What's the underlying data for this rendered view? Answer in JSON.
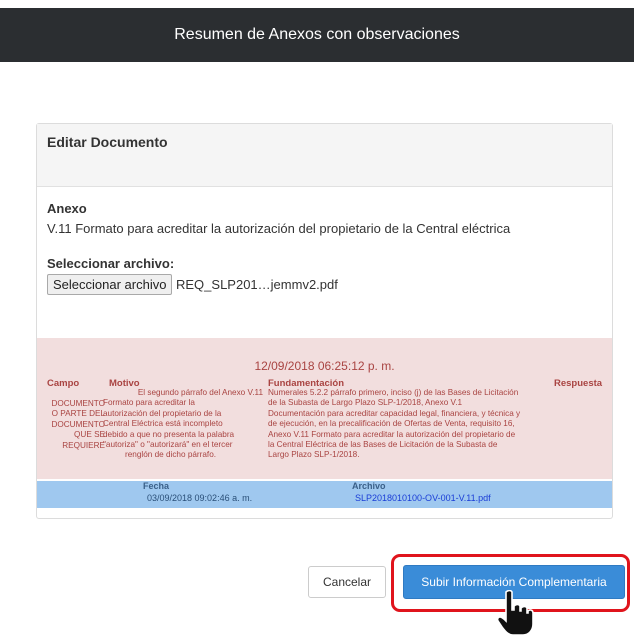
{
  "header": {
    "title": "Resumen de Anexos con observaciones"
  },
  "card": {
    "title": "Editar Documento",
    "anexo_label": "Anexo",
    "anexo_value": "V.11 Formato para acreditar la autorización del propietario de la Central eléctrica",
    "file_label": "Seleccionar archivo:",
    "file_button": "Seleccionar archivo",
    "file_name": "REQ_SLP201…jemmv2.pdf"
  },
  "observation": {
    "date": "12/09/2018 06:25:12 p. m.",
    "headers": {
      "campo": "Campo",
      "motivo": "Motivo",
      "fundamentacion": "Fundamentación",
      "respuesta": "Respuesta"
    },
    "campo_lines": [
      "DOCUMENTO",
      "O PARTE DEL",
      "DOCUMENTO",
      "QUE SE",
      "REQUIERE"
    ],
    "motivo_lines": [
      "El segundo párrafo del Anexo V.11",
      "Formato para acreditar la",
      "autorización del propietario de la",
      "Central Eléctrica está incompleto",
      "debido a que no presenta la palabra",
      "\"autoriza\" o \"autorizará\" en el tercer",
      "renglón de dicho párrafo."
    ],
    "fundamentacion_lines": [
      "Numerales 5.2.2 párrafo primero, inciso (j) de las Bases de Licitación",
      "de la Subasta de Largo Plazo SLP-1/2018, Anexo V.1",
      "Documentación para acreditar capacidad legal, financiera, y técnica y",
      "de ejecución, en la precalificación de Ofertas de Venta, requisito 16,",
      "Anexo V.11 Formato para acreditar la autorización del propietario de",
      "la Central Eléctrica de las Bases de Licitación de la Subasta de",
      "Largo Plazo SLP-1/2018."
    ],
    "file": {
      "fecha_label": "Fecha",
      "fecha_value": "03/09/2018 09:02:46 a. m.",
      "archivo_label": "Archivo",
      "archivo_value": "SLP2018010100-OV-001-V.11.pdf"
    }
  },
  "actions": {
    "cancel": "Cancelar",
    "submit": "Subir Información Complementaria"
  },
  "colors": {
    "header_bg": "#2b2e31",
    "alert_bg": "#f2dede",
    "alert_text": "#a94442",
    "file_row_bg": "#9fc8ef",
    "primary": "#3a8cd8",
    "highlight": "#e0141c"
  },
  "icons": {
    "cursor": "hand-pointer-icon"
  }
}
